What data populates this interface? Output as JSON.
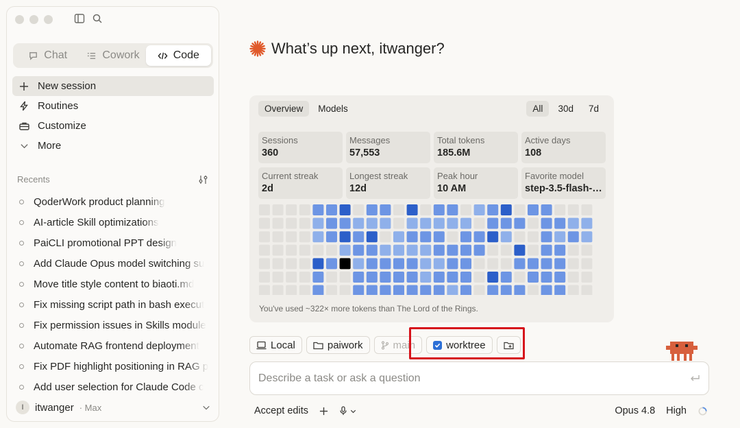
{
  "sidebar": {
    "modes": [
      {
        "label": "Chat",
        "icon": "chat-bubble-icon"
      },
      {
        "label": "Cowork",
        "icon": "list-icon"
      },
      {
        "label": "Code",
        "icon": "code-icon"
      }
    ],
    "nav": [
      {
        "label": "New session",
        "icon": "plus-icon"
      },
      {
        "label": "Routines",
        "icon": "lightning-icon"
      },
      {
        "label": "Customize",
        "icon": "briefcase-icon"
      },
      {
        "label": "More",
        "icon": "chevron-down-icon"
      }
    ],
    "recents_label": "Recents",
    "recents": [
      "QoderWork product planning",
      "AI-article Skill optimizations",
      "PaiCLI promotional PPT design",
      "Add Claude Opus model switching su",
      "Move title style content to biaoti.md",
      "Fix missing script path in bash execut",
      "Fix permission issues in Skills module",
      "Automate RAG frontend deployment",
      "Fix PDF highlight positioning in RAG p",
      "Add user selection for Claude Code c"
    ],
    "user": {
      "initial": "I",
      "name": "itwanger",
      "plan": "· Max"
    }
  },
  "main": {
    "greeting": "What’s up next, itwanger?",
    "stats": {
      "tabs_left": [
        "Overview",
        "Models"
      ],
      "tabs_right": [
        "All",
        "30d",
        "7d"
      ],
      "cards": [
        {
          "label": "Sessions",
          "value": "360"
        },
        {
          "label": "Messages",
          "value": "57,553"
        },
        {
          "label": "Total tokens",
          "value": "185.6M"
        },
        {
          "label": "Active days",
          "value": "108"
        },
        {
          "label": "Current streak",
          "value": "2d"
        },
        {
          "label": "Longest streak",
          "value": "12d"
        },
        {
          "label": "Peak hour",
          "value": "10 AM"
        },
        {
          "label": "Favorite model",
          "value": "step-3.5-flash-…"
        }
      ],
      "heatmap_levels": [
        "0000223022030220123022000",
        "0000122111011111022202211",
        "0000123230122202231002121",
        "0000001221111222200302200",
        "0000324122221122000222200",
        "0000200222221222032022200",
        "0000200222222212022202200"
      ],
      "heatmap_colors": [
        "#e2e0dc",
        "#8fb0ea",
        "#6d95e4",
        "#2c5fc9"
      ],
      "footnote": "You've used ~322× more tokens than The Lord of the Rings."
    },
    "chips": {
      "local": "Local",
      "folder": "paiwork",
      "branch": "main",
      "worktree": "worktree"
    },
    "input_placeholder": "Describe a task or ask a question",
    "bottom": {
      "accept": "Accept edits",
      "model": "Opus 4.8",
      "effort": "High"
    },
    "accent_color": "#e05a2b"
  }
}
